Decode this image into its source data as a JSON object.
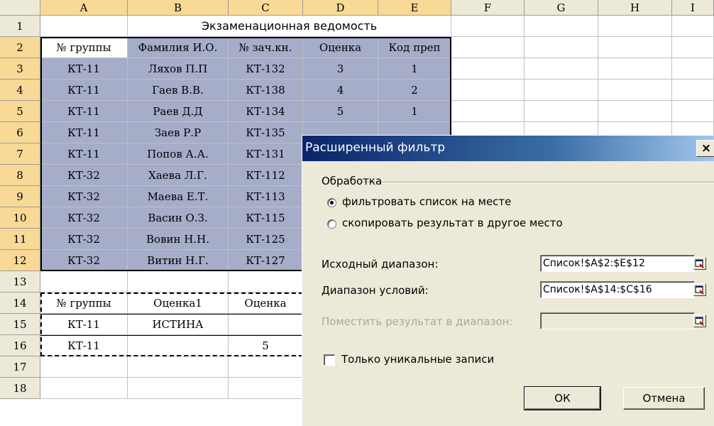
{
  "columns": [
    "",
    "A",
    "B",
    "C",
    "D",
    "E",
    "F",
    "G",
    "H",
    "I"
  ],
  "rows": [
    "1",
    "2",
    "3",
    "4",
    "5",
    "6",
    "7",
    "8",
    "9",
    "10",
    "11",
    "12",
    "13",
    "14",
    "15",
    "16",
    "17",
    "18"
  ],
  "sheet_title": "Экзаменационная ведомость",
  "table_header": [
    "№ группы",
    "Фамилия И.О.",
    "№ зач.кн.",
    "Оценка",
    "Код преп"
  ],
  "table_rows": [
    [
      "КТ-11",
      "Ляхов П.П",
      "КТ-132",
      "3",
      "1"
    ],
    [
      "КТ-11",
      "Гаев В.В.",
      "КТ-138",
      "4",
      "2"
    ],
    [
      "КТ-11",
      "Раев Д.Д",
      "КТ-134",
      "5",
      "1"
    ],
    [
      "КТ-11",
      "Заев Р.Р",
      "КТ-135",
      "",
      ""
    ],
    [
      "КТ-11",
      "Попов А.А.",
      "КТ-131",
      "",
      ""
    ],
    [
      "КТ-32",
      "Хаева Л.Г.",
      "КТ-112",
      "",
      ""
    ],
    [
      "КТ-32",
      "Маева Е.Т.",
      "КТ-113",
      "",
      ""
    ],
    [
      "КТ-32",
      "Васин О.З.",
      "КТ-115",
      "",
      ""
    ],
    [
      "КТ-32",
      "Вовин Н.Н.",
      "КТ-125",
      "",
      ""
    ],
    [
      "КТ-32",
      "Витин Н.Г.",
      "КТ-127",
      "",
      ""
    ]
  ],
  "criteria_header": [
    "№ группы",
    "Оценка1",
    "Оценка"
  ],
  "criteria_rows": [
    [
      "КТ-11",
      "ИСТИНА",
      ""
    ],
    [
      "КТ-11",
      "",
      "5"
    ]
  ],
  "dialog": {
    "title": "Расширенный фильтр",
    "close_glyph": "×",
    "group_label": "Обработка",
    "radio_filter_in_place": "фильтровать список на месте",
    "radio_copy": "скопировать результат в другое место",
    "list_range_label": "Исходный диапазон:",
    "list_range_value": "Список!$A$2:$E$12",
    "criteria_range_label": "Диапазон условий:",
    "criteria_range_value": "Список!$A$14:$C$16",
    "copy_to_label": "Поместить результат в диапазон:",
    "copy_to_value": "",
    "unique_label": "Только уникальные записи",
    "ok_label": "ОК",
    "cancel_label": "Отмена"
  },
  "colors": {
    "selection": "#a5adc9",
    "header_bg": "#ece9d8",
    "header_selected": "#f9d996",
    "title_bar": "#0a246a"
  }
}
